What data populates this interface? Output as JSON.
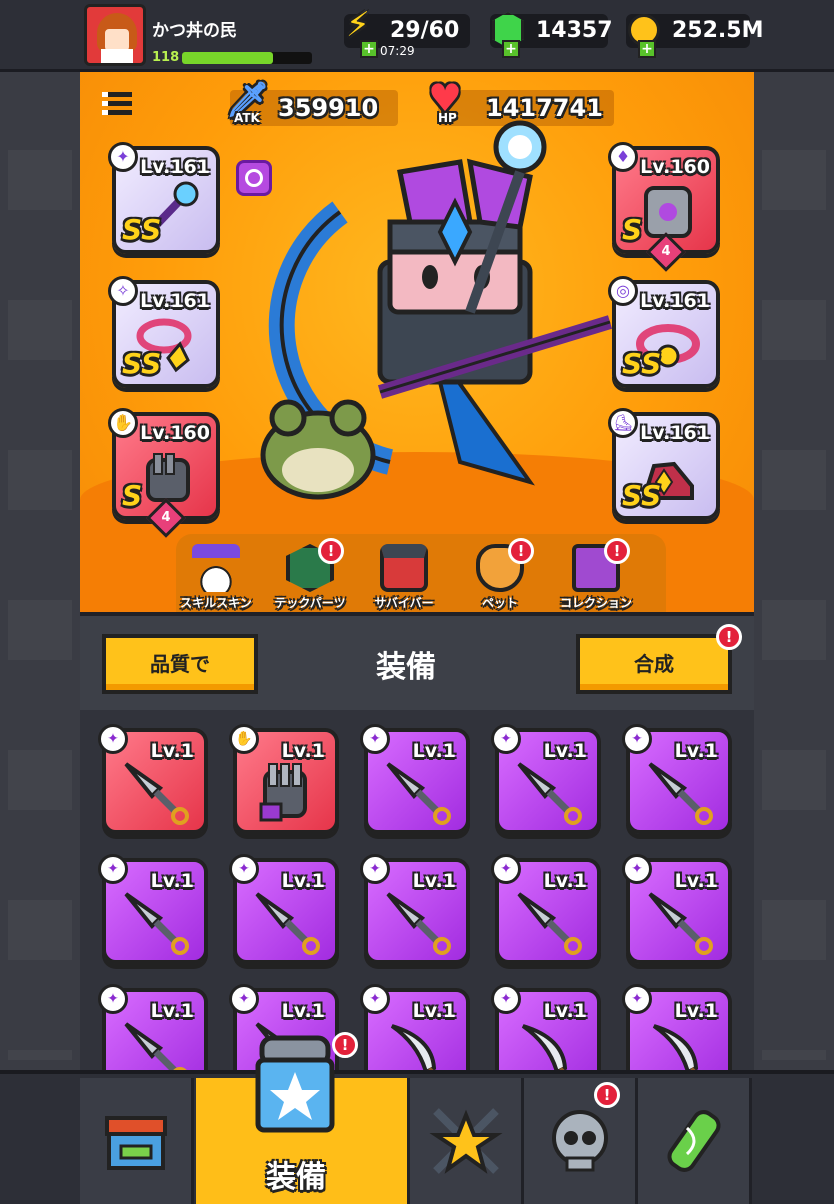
{
  "player": {
    "name": "かつ丼の民",
    "level": "118",
    "exp_fraction": 0.7
  },
  "currency": {
    "energy": "29/60",
    "energy_timer": "07:29",
    "gems": "14357",
    "gold": "252.5M"
  },
  "stats": {
    "atk_label": "ATK",
    "atk_value": "359910",
    "hp_label": "HP",
    "hp_value": "1417741"
  },
  "equipped": [
    {
      "slot": "weapon",
      "level": "Lv.161",
      "grade": "SS",
      "color": "violet"
    },
    {
      "slot": "armor",
      "level": "Lv.160",
      "grade": "S",
      "color": "red",
      "stars": "4"
    },
    {
      "slot": "necklace",
      "level": "Lv.161",
      "grade": "SS",
      "color": "violet"
    },
    {
      "slot": "belt",
      "level": "Lv.161",
      "grade": "SS",
      "color": "violet"
    },
    {
      "slot": "gloves",
      "level": "Lv.160",
      "grade": "S",
      "color": "red",
      "stars": "4"
    },
    {
      "slot": "boots",
      "level": "Lv.161",
      "grade": "SS",
      "color": "violet"
    }
  ],
  "tabs": [
    {
      "label": "スキルスキン",
      "alert": false
    },
    {
      "label": "テックパーツ",
      "alert": true
    },
    {
      "label": "サバイバー",
      "alert": false
    },
    {
      "label": "ペット",
      "alert": true
    },
    {
      "label": "コレクション",
      "alert": true
    }
  ],
  "equip_bar": {
    "sort_label": "品質で",
    "title": "装備",
    "merge_label": "合成",
    "merge_alert": true
  },
  "inventory": [
    {
      "level": "Lv.1",
      "color": "red",
      "item": "kunai"
    },
    {
      "level": "Lv.1",
      "color": "red",
      "item": "gauntlet"
    },
    {
      "level": "Lv.1",
      "color": "purple",
      "item": "kunai"
    },
    {
      "level": "Lv.1",
      "color": "purple",
      "item": "kunai"
    },
    {
      "level": "Lv.1",
      "color": "purple",
      "item": "kunai"
    },
    {
      "level": "Lv.1",
      "color": "purple",
      "item": "kunai"
    },
    {
      "level": "Lv.1",
      "color": "purple",
      "item": "kunai"
    },
    {
      "level": "Lv.1",
      "color": "purple",
      "item": "kunai"
    },
    {
      "level": "Lv.1",
      "color": "purple",
      "item": "kunai"
    },
    {
      "level": "Lv.1",
      "color": "purple",
      "item": "kunai"
    },
    {
      "level": "Lv.1",
      "color": "purple",
      "item": "kunai"
    },
    {
      "level": "Lv.1",
      "color": "purple",
      "item": "kunai"
    },
    {
      "level": "Lv.1",
      "color": "purple",
      "item": "blade"
    },
    {
      "level": "Lv.1",
      "color": "purple",
      "item": "blade"
    },
    {
      "level": "Lv.1",
      "color": "purple",
      "item": "blade"
    }
  ],
  "nav": [
    {
      "name": "shop",
      "label": "",
      "alert": false
    },
    {
      "name": "equipment",
      "label": "装備",
      "alert": true,
      "active": true
    },
    {
      "name": "battle",
      "label": "",
      "alert": false
    },
    {
      "name": "challenge",
      "label": "",
      "alert": true
    },
    {
      "name": "evolve",
      "label": "",
      "alert": false
    }
  ],
  "colors": {
    "orange": "#ff9d0a",
    "gold": "#ffc21a",
    "red": "#e6354a",
    "purple": "#a22ce0",
    "violet": "#c9bdf0",
    "alert": "#e3213b"
  }
}
